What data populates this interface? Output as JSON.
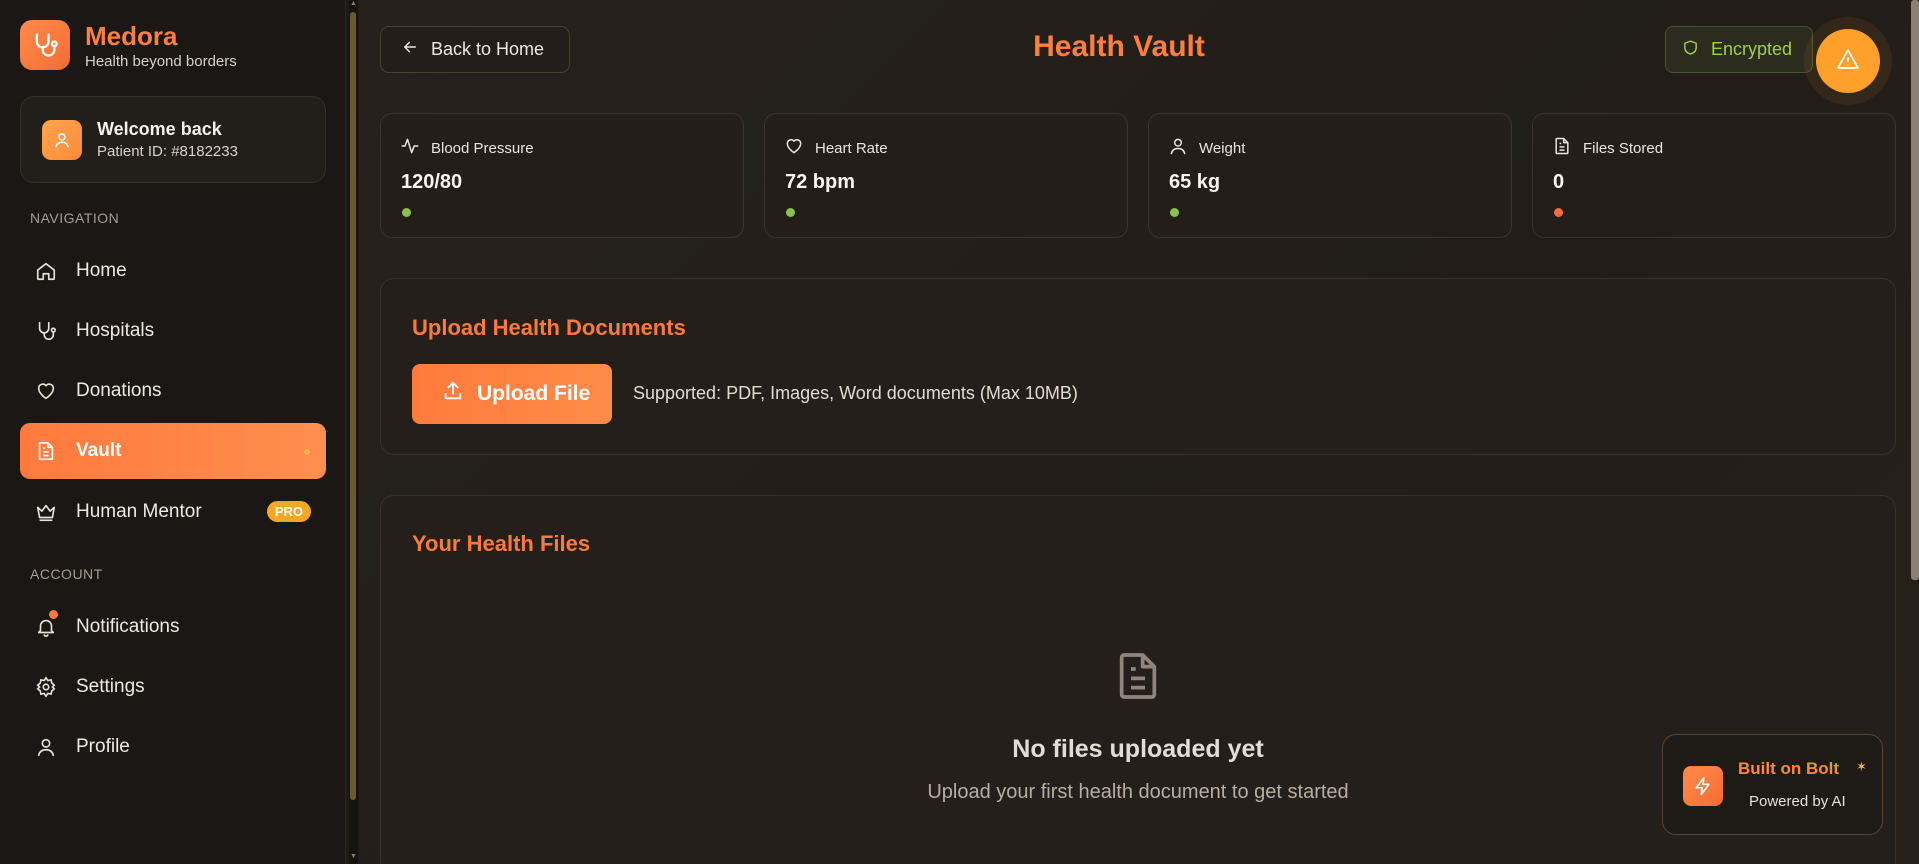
{
  "brand": {
    "name": "Medora",
    "tagline": "Health beyond borders"
  },
  "user": {
    "welcome": "Welcome back",
    "patient_id": "Patient ID: #8182233"
  },
  "sidebar": {
    "nav_label": "NAVIGATION",
    "nav_items": [
      {
        "label": "Home",
        "icon": "home-icon"
      },
      {
        "label": "Hospitals",
        "icon": "stethoscope-icon"
      },
      {
        "label": "Donations",
        "icon": "heart-icon"
      },
      {
        "label": "Vault",
        "icon": "file-text-icon",
        "active": true
      },
      {
        "label": "Human Mentor",
        "icon": "crown-icon",
        "badge": "PRO"
      }
    ],
    "account_label": "ACCOUNT",
    "account_items": [
      {
        "label": "Notifications",
        "icon": "bell-icon",
        "has_dot": true
      },
      {
        "label": "Settings",
        "icon": "gear-icon"
      },
      {
        "label": "Profile",
        "icon": "user-icon"
      }
    ]
  },
  "header": {
    "back_label": "Back to Home",
    "title": "Health Vault",
    "encrypted_label": "Encrypted"
  },
  "stats": [
    {
      "label": "Blood Pressure",
      "value": "120/80",
      "icon": "activity-icon",
      "status_color": "#8bc34a"
    },
    {
      "label": "Heart Rate",
      "value": "72 bpm",
      "icon": "heart-icon",
      "status_color": "#8bc34a"
    },
    {
      "label": "Weight",
      "value": "65 kg",
      "icon": "user-icon",
      "status_color": "#8bc34a"
    },
    {
      "label": "Files Stored",
      "value": "0",
      "icon": "file-text-icon",
      "status_color": "#ff6b3d"
    }
  ],
  "upload": {
    "title": "Upload Health Documents",
    "button_label": "Upload File",
    "supported_text": "Supported: PDF, Images, Word documents (Max 10MB)"
  },
  "files": {
    "title": "Your Health Files",
    "empty_title": "No files uploaded yet",
    "empty_subtitle": "Upload your first health document to get started"
  },
  "bolt": {
    "title": "Built on Bolt",
    "subtitle": "Powered by AI"
  },
  "colors": {
    "accent": "#ff7a3d",
    "background": "#1d1a17",
    "success": "#8bc34a",
    "warning": "#ffa02a"
  }
}
